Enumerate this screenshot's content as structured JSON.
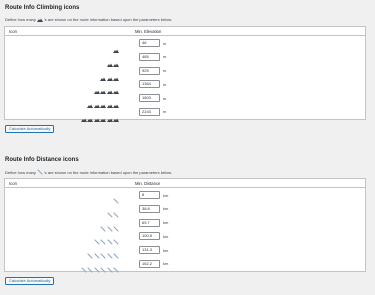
{
  "climbing": {
    "title": "Route Info Climbing icons",
    "desc_before": "Define how many",
    "desc_after": "'s are shown on the route information based upon the parameters below.",
    "icon_name": "mountain-icon",
    "header_icon": "Icon",
    "header_value": "Min. Elevation",
    "unit": "m",
    "rows": [
      {
        "count": 1,
        "value": "46"
      },
      {
        "count": 2,
        "value": "485"
      },
      {
        "count": 3,
        "value": "925"
      },
      {
        "count": 4,
        "value": "1364"
      },
      {
        "count": 5,
        "value": "1803"
      },
      {
        "count": 6,
        "value": "2243"
      }
    ],
    "button": "Calculate Automatically"
  },
  "distance": {
    "title": "Route Info Distance icons",
    "desc_before": "Define how many",
    "desc_after": "'s are shown on the route information based upon the parameters below.",
    "icon_name": "bicycle-icon",
    "header_icon": "Icon",
    "header_value": "Min. Distance",
    "unit": "km",
    "rows": [
      {
        "count": 1,
        "value": "8"
      },
      {
        "count": 2,
        "value": "38.8"
      },
      {
        "count": 3,
        "value": "69.7"
      },
      {
        "count": 4,
        "value": "100.5"
      },
      {
        "count": 5,
        "value": "131.3"
      },
      {
        "count": 6,
        "value": "162.2"
      }
    ],
    "button": "Calculate Automatically"
  },
  "colors": {
    "accent": "#2271b1",
    "mountain": "#3c434a",
    "bike": "#8fa8c0"
  }
}
